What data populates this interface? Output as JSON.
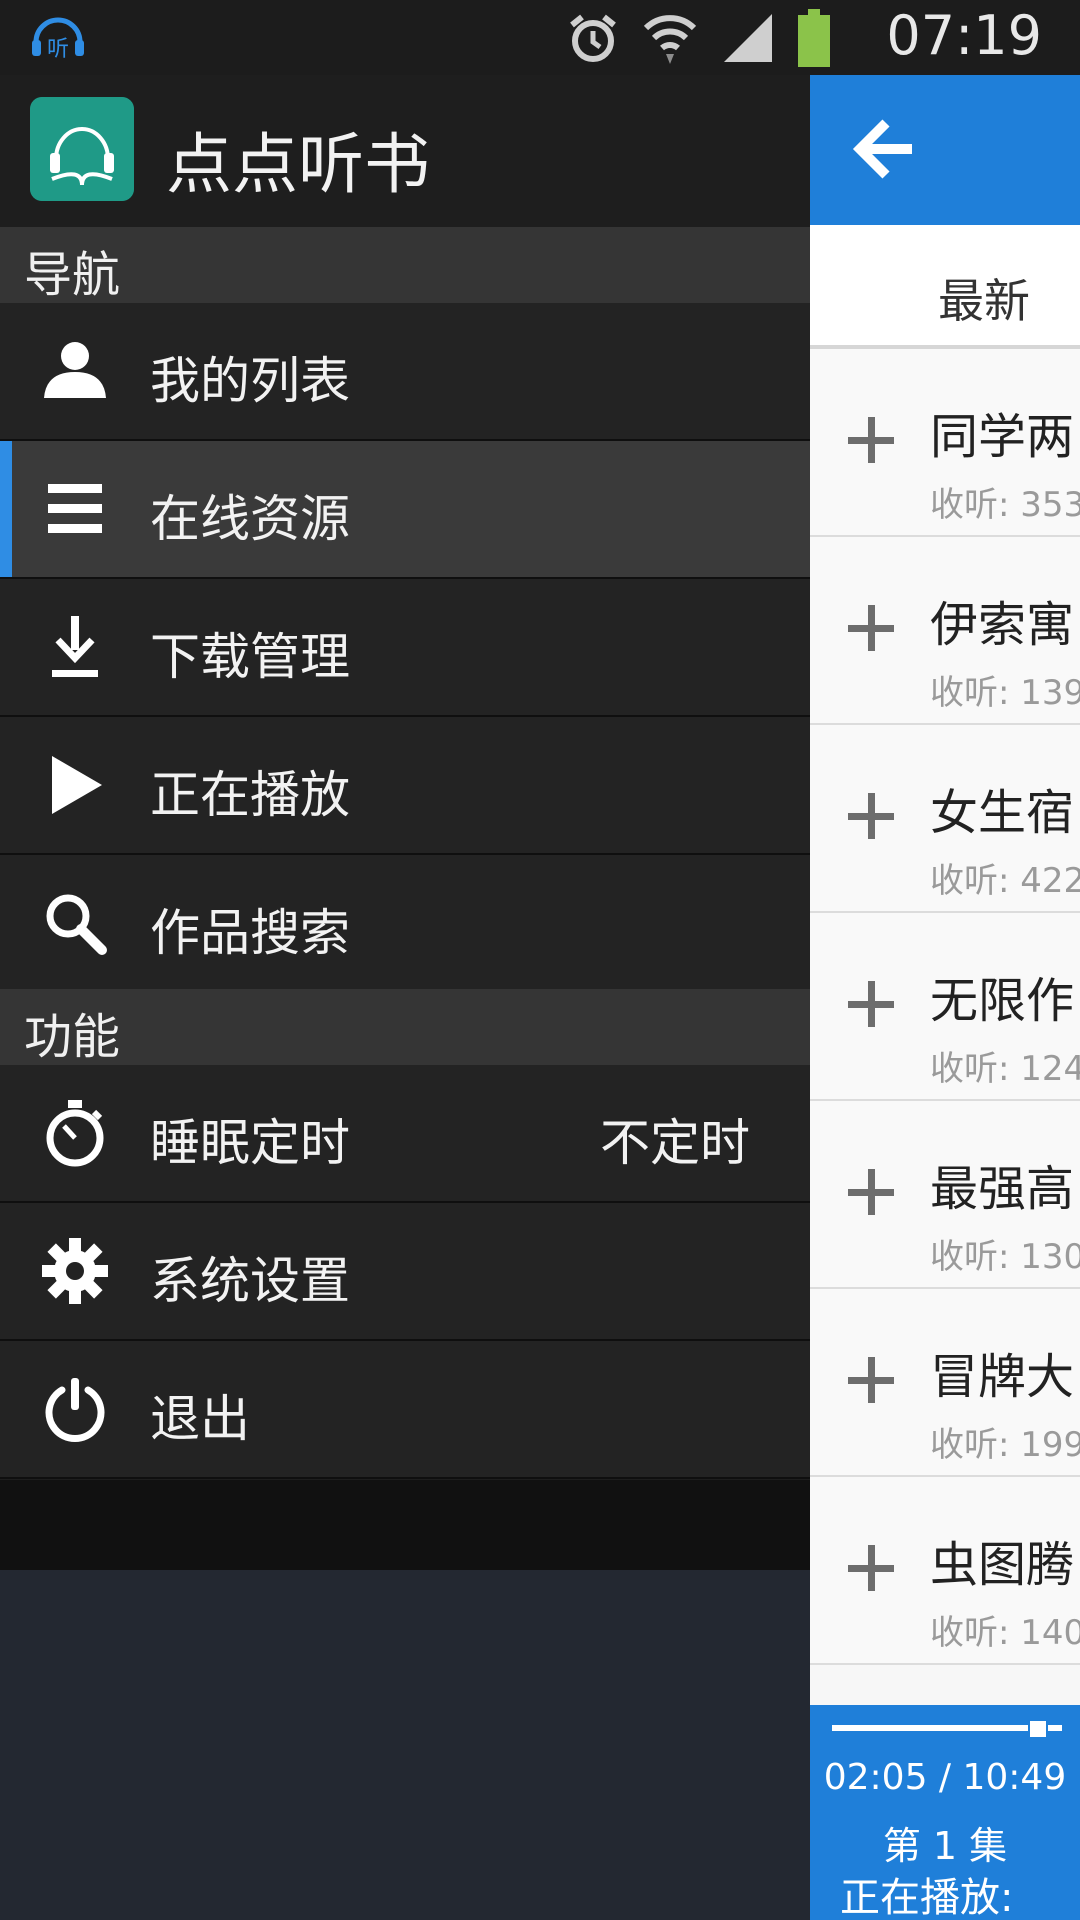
{
  "status_bar": {
    "time": "07:19",
    "notification_icon": "headphones-ting-icon",
    "icons": [
      "alarm-icon",
      "wifi-icon",
      "signal-icon",
      "battery-icon"
    ]
  },
  "drawer": {
    "app_title": "点点听书",
    "sections": {
      "navigation": "导航",
      "functions": "功能"
    },
    "nav_items": [
      {
        "label": "我的列表",
        "icon": "user-icon"
      },
      {
        "label": "在线资源",
        "icon": "list-icon",
        "selected": true
      },
      {
        "label": "下载管理",
        "icon": "download-icon"
      },
      {
        "label": "正在播放",
        "icon": "play-icon"
      },
      {
        "label": "作品搜索",
        "icon": "search-icon"
      }
    ],
    "function_items": [
      {
        "label": "睡眠定时",
        "icon": "stopwatch-icon",
        "value": "不定时"
      },
      {
        "label": "系统设置",
        "icon": "gear-icon"
      },
      {
        "label": "退出",
        "icon": "power-icon"
      }
    ]
  },
  "content": {
    "tab_label": "最新",
    "books": [
      {
        "title": "同学两",
        "plays": "收听: 353"
      },
      {
        "title": "伊索寓",
        "plays": "收听: 139"
      },
      {
        "title": "女生宿",
        "plays": "收听: 422"
      },
      {
        "title": "无限作",
        "plays": "收听: 124"
      },
      {
        "title": "最强高",
        "plays": "收听: 130"
      },
      {
        "title": "冒牌大",
        "plays": "收听: 199"
      },
      {
        "title": "虫图腾",
        "plays": "收听: 140"
      }
    ],
    "player": {
      "time": "02:05 / 10:49",
      "episode": "第 1 集",
      "now_playing": "正在播放:",
      "progress": 0.19
    }
  },
  "colors": {
    "accent_blue": "#1f7fd9",
    "logo_teal": "#1f9a87",
    "selected_indicator": "#2f8de4"
  }
}
